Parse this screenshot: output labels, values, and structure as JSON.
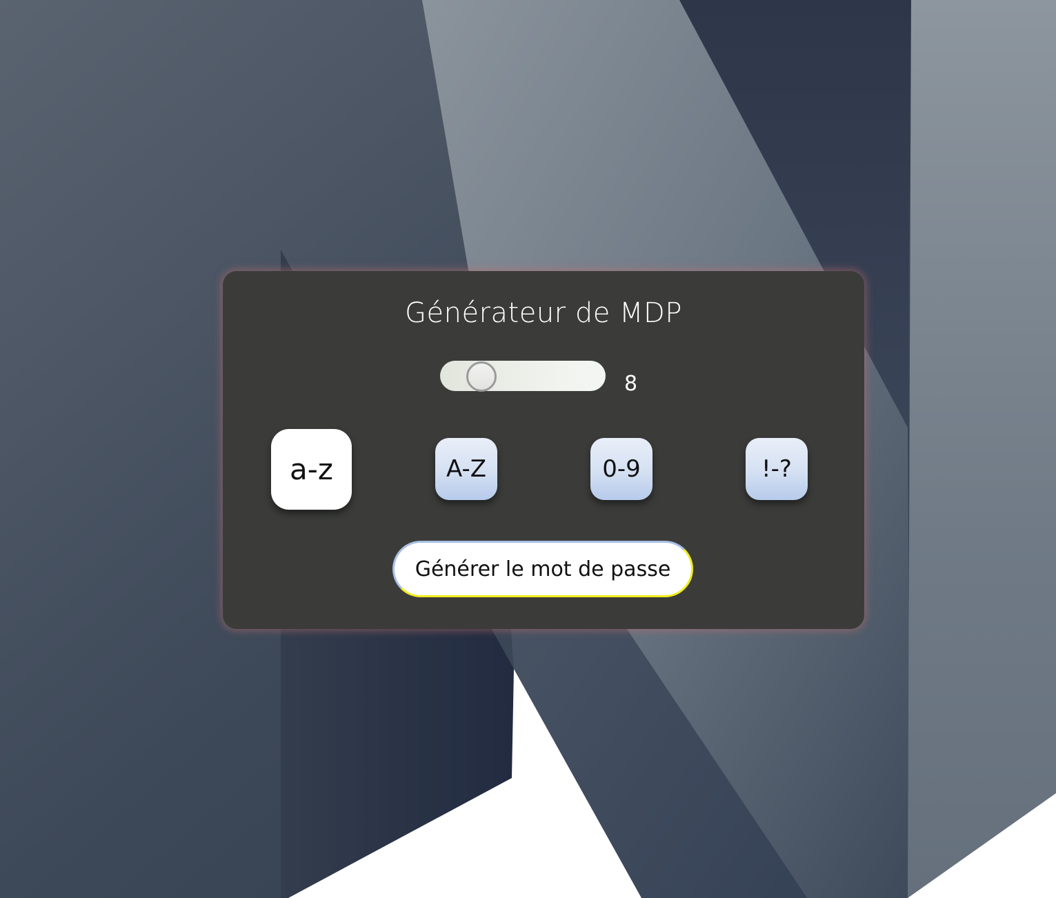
{
  "card": {
    "title": "Générateur de MDP"
  },
  "slider": {
    "value": "8"
  },
  "options": [
    {
      "label": "a-z",
      "selected": true
    },
    {
      "label": "A-Z",
      "selected": false
    },
    {
      "label": "0-9",
      "selected": false
    },
    {
      "label": "!-?",
      "selected": false
    }
  ],
  "generate_button": {
    "label": "Générer le mot de passe"
  },
  "colors": {
    "card_background": "#3b3c3a",
    "card_glow": "#be6e6e",
    "button_border": "#f1ec1c",
    "option_gradient_end": "#b7cbec"
  }
}
